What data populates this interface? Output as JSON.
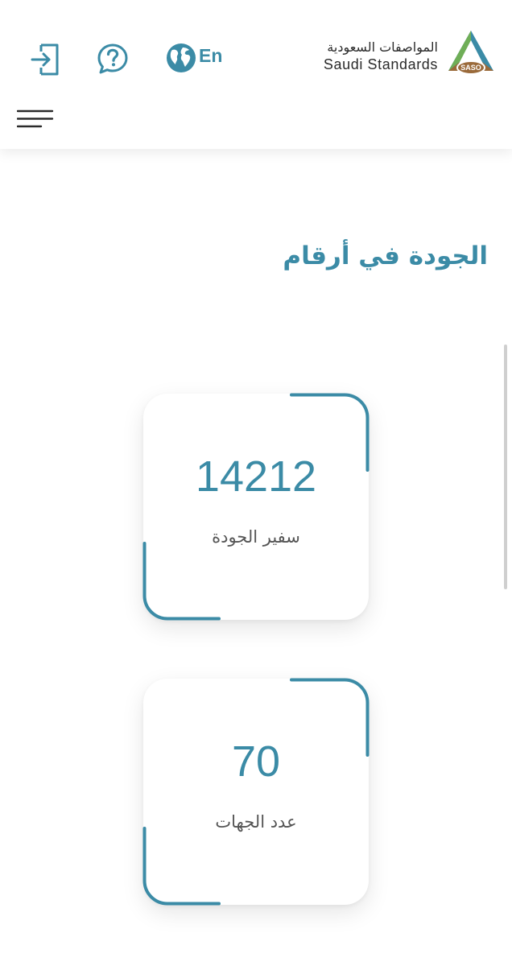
{
  "header": {
    "language_toggle": "En",
    "logo": {
      "arabic_name": "المواصفات السعودية",
      "english_name": "Saudi Standards",
      "badge_text": "SASO"
    },
    "icons": {
      "login": "login-icon",
      "help": "help-icon",
      "language": "globe-icon",
      "menu": "hamburger-menu-icon"
    }
  },
  "main": {
    "section_title": "الجودة في أرقام",
    "stats": [
      {
        "value": "14212",
        "label": "سفير الجودة"
      },
      {
        "value": "70",
        "label": "عدد الجهات"
      }
    ]
  },
  "colors": {
    "accent": "#3b8ba6",
    "text_dark": "#2a2a2a",
    "label_gray": "#555555",
    "logo_blue": "#3b8ba6",
    "logo_green": "#6fae57",
    "logo_brown": "#9a6a3a"
  }
}
